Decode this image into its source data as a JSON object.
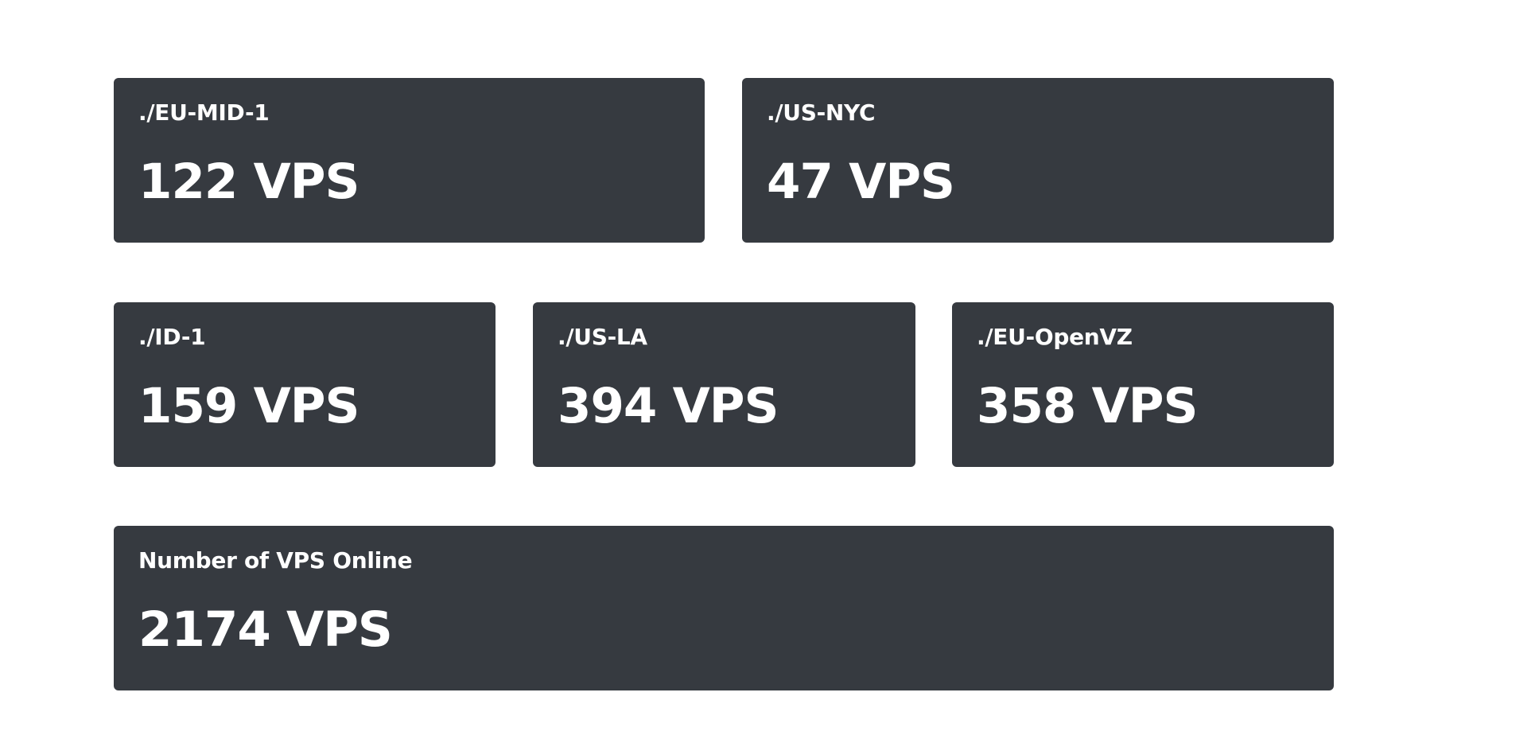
{
  "cards": [
    {
      "title": "./EU-MID-1",
      "value": "122 VPS"
    },
    {
      "title": "./US-NYC",
      "value": "47 VPS"
    },
    {
      "title": "./ID-1",
      "value": "159 VPS"
    },
    {
      "title": "./US-LA",
      "value": "394 VPS"
    },
    {
      "title": "./EU-OpenVZ",
      "value": "358 VPS"
    }
  ],
  "total": {
    "title": "Number of VPS Online",
    "value": "2174 VPS"
  },
  "colors": {
    "card_bg": "#363a40",
    "text": "#ffffff",
    "page_bg": "#ffffff"
  }
}
